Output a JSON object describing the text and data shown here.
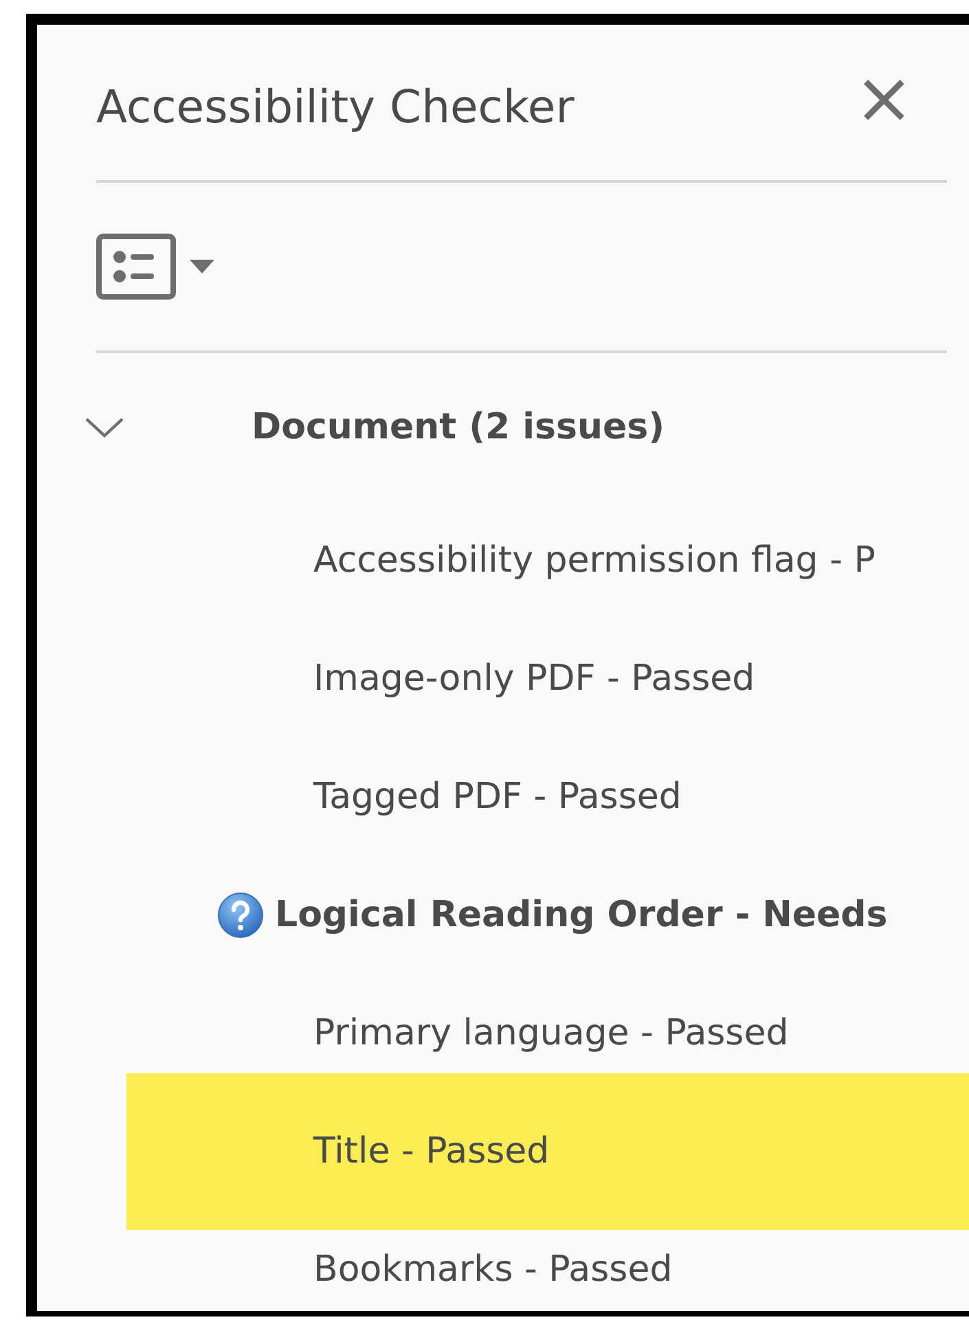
{
  "panel": {
    "title": "Accessibility Checker",
    "close": "×"
  },
  "groups": [
    {
      "label": "Document (2 issues)",
      "expanded": true,
      "children": [
        {
          "label": "Accessibility permission flag - P",
          "kind": "passed",
          "selected": false
        },
        {
          "label": "Image-only PDF - Passed",
          "kind": "passed",
          "selected": false
        },
        {
          "label": "Tagged PDF - Passed",
          "kind": "passed",
          "selected": false
        },
        {
          "label": "Logical Reading Order - Needs",
          "kind": "needs_check",
          "selected": false
        },
        {
          "label": "Primary language - Passed",
          "kind": "passed",
          "selected": false
        },
        {
          "label": "Title - Passed",
          "kind": "passed",
          "selected": true
        },
        {
          "label": "Bookmarks - Passed",
          "kind": "passed",
          "selected": false
        }
      ]
    }
  ]
}
